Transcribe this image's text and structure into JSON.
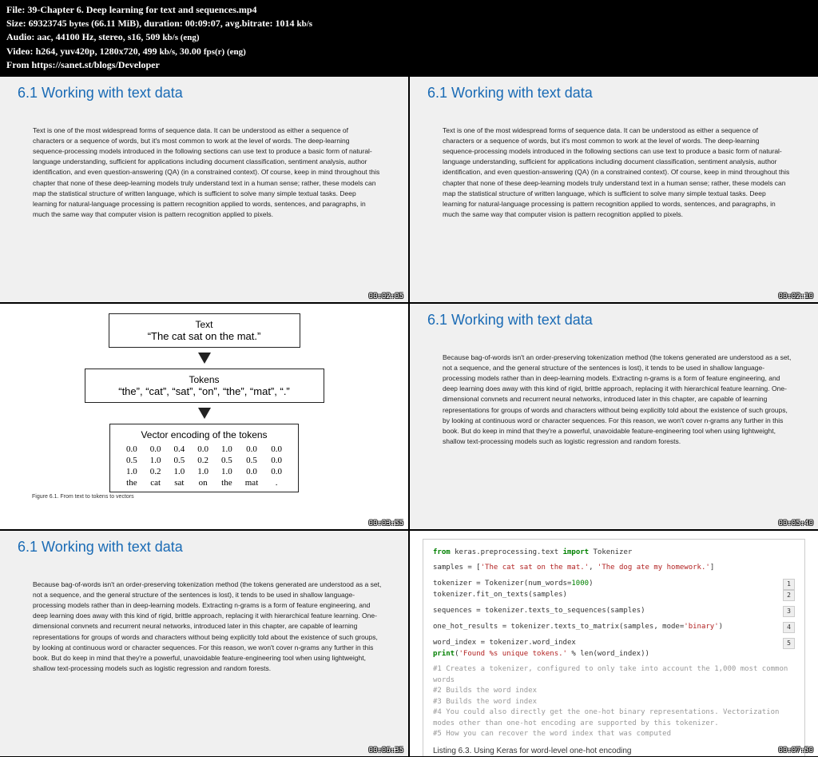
{
  "header": {
    "file_label": "File:",
    "file": "39-Chapter 6. Deep learning for text and sequences.mp4",
    "size_label": "Size:",
    "size_bytes": "69323745",
    "size_unit": "bytes",
    "size_mib": "(66.11 MiB),",
    "duration_label": "duration:",
    "duration": "00:09:07,",
    "bitrate_label": "avg.bitrate:",
    "bitrate": "1014",
    "bitrate_unit": "kb/s",
    "audio_label": "Audio:",
    "audio": "aac, 44100 Hz, stereo, s16, 509",
    "audio_unit": "kb/s (eng)",
    "video_label": "Video:",
    "video": "h264, yuv420p, 1280x720, 499",
    "video_unit": "kb/s,",
    "fps": "30.00",
    "fps_unit": "fps(r) (eng)",
    "from_label": "From",
    "from": "https://sanet.st/blogs/Developer"
  },
  "title": "6.1 Working with text data",
  "para1": "Text is one of the most widespread forms of sequence data. It can be understood as either a sequence of characters or a sequence of words, but it's most common to work at the level of words. The deep-learning sequence-processing models introduced in the following sections can use text to produce a basic form of natural-language understanding, sufficient for applications including document classification, sentiment analysis, author identification, and even question-answering (QA) (in a constrained context). Of course, keep in mind throughout this chapter that none of these deep-learning models truly understand text in a human sense; rather, these models can map the statistical structure of written language, which is sufficient to solve many simple textual tasks. Deep learning for natural-language processing is pattern recognition applied to words, sentences, and paragraphs, in much the same way that computer vision is pattern recognition applied to pixels.",
  "para2": "Because bag-of-words isn't an order-preserving tokenization method (the tokens generated are understood as a set, not a sequence, and the general structure of the sentences is lost), it tends to be used in shallow language-processing models rather than in deep-learning models. Extracting n-grams is a form of feature engineering, and deep learning does away with this kind of rigid, brittle approach, replacing it with hierarchical feature learning. One-dimensional convnets and recurrent neural networks, introduced later in this chapter, are capable of learning representations for groups of words and characters without being explicitly told about the existence of such groups, by looking at continuous word or character sequences. For this reason, we won't cover n-grams any further in this book. But do keep in mind that they're a powerful, unavoidable feature-engineering tool when using lightweight, shallow text-processing models such as logistic regression and random forests.",
  "ts": [
    "00:02:05",
    "00:02:10",
    "00:03:55",
    "00:05:40",
    "00:06:35",
    "00:07:50"
  ],
  "diagram": {
    "text_label": "Text",
    "text_value": "“The cat sat on the mat.”",
    "tokens_label": "Tokens",
    "tokens_value": "“the”, “cat”, “sat”, “on”, “the”, “mat”, “.”",
    "vector_label": "Vector encoding of the tokens",
    "caption": "Figure 6.1. From text to tokens to vectors",
    "matrix": {
      "rows": [
        [
          "0.0",
          "0.0",
          "0.4",
          "0.0",
          "1.0",
          "0.0",
          "0.0"
        ],
        [
          "0.5",
          "1.0",
          "0.5",
          "0.2",
          "0.5",
          "0.5",
          "0.0"
        ],
        [
          "1.0",
          "0.2",
          "1.0",
          "1.0",
          "1.0",
          "0.0",
          "0.0"
        ],
        [
          "the",
          "cat",
          "sat",
          "on",
          "the",
          "mat",
          "."
        ]
      ]
    }
  },
  "code": {
    "l1a": "from",
    "l1b": " keras.preprocessing.text ",
    "l1c": "import",
    "l1d": " Tokenizer",
    "l2a": "samples = [",
    "l2b": "'The cat sat on the mat.'",
    "l2c": ", ",
    "l2d": "'The dog ate my homework.'",
    "l2e": "]",
    "l3a": "tokenizer = Tokenizer(num_words=",
    "l3b": "1000",
    "l3c": ")",
    "l3n": "1",
    "l4": "tokenizer.fit_on_texts(samples)",
    "l4n": "2",
    "l5": "sequences = tokenizer.texts_to_sequences(samples)",
    "l5n": "3",
    "l6a": "one_hot_results = tokenizer.texts_to_matrix(samples, mode=",
    "l6b": "'binary'",
    "l6c": ")",
    "l6n": "4",
    "l7": "word_index = tokenizer.word_index",
    "l7n": "5",
    "l8a": "print",
    "l8b": "(",
    "l8c": "'Found %s unique tokens.'",
    "l8d": " % len(word_index))",
    "c1": "#1 Creates a tokenizer, configured to only take into account the 1,000 most common words",
    "c2": "#2 Builds the word index",
    "c3": "#3 Builds the word index",
    "c4": "#4 You could also directly get the one-hot binary representations. Vectorization modes other than one-hot encoding are supported by this tokenizer.",
    "c5": "#5 How you can recover the word index that was computed",
    "listing": "Listing 6.3. Using Keras for word-level one-hot encoding"
  }
}
